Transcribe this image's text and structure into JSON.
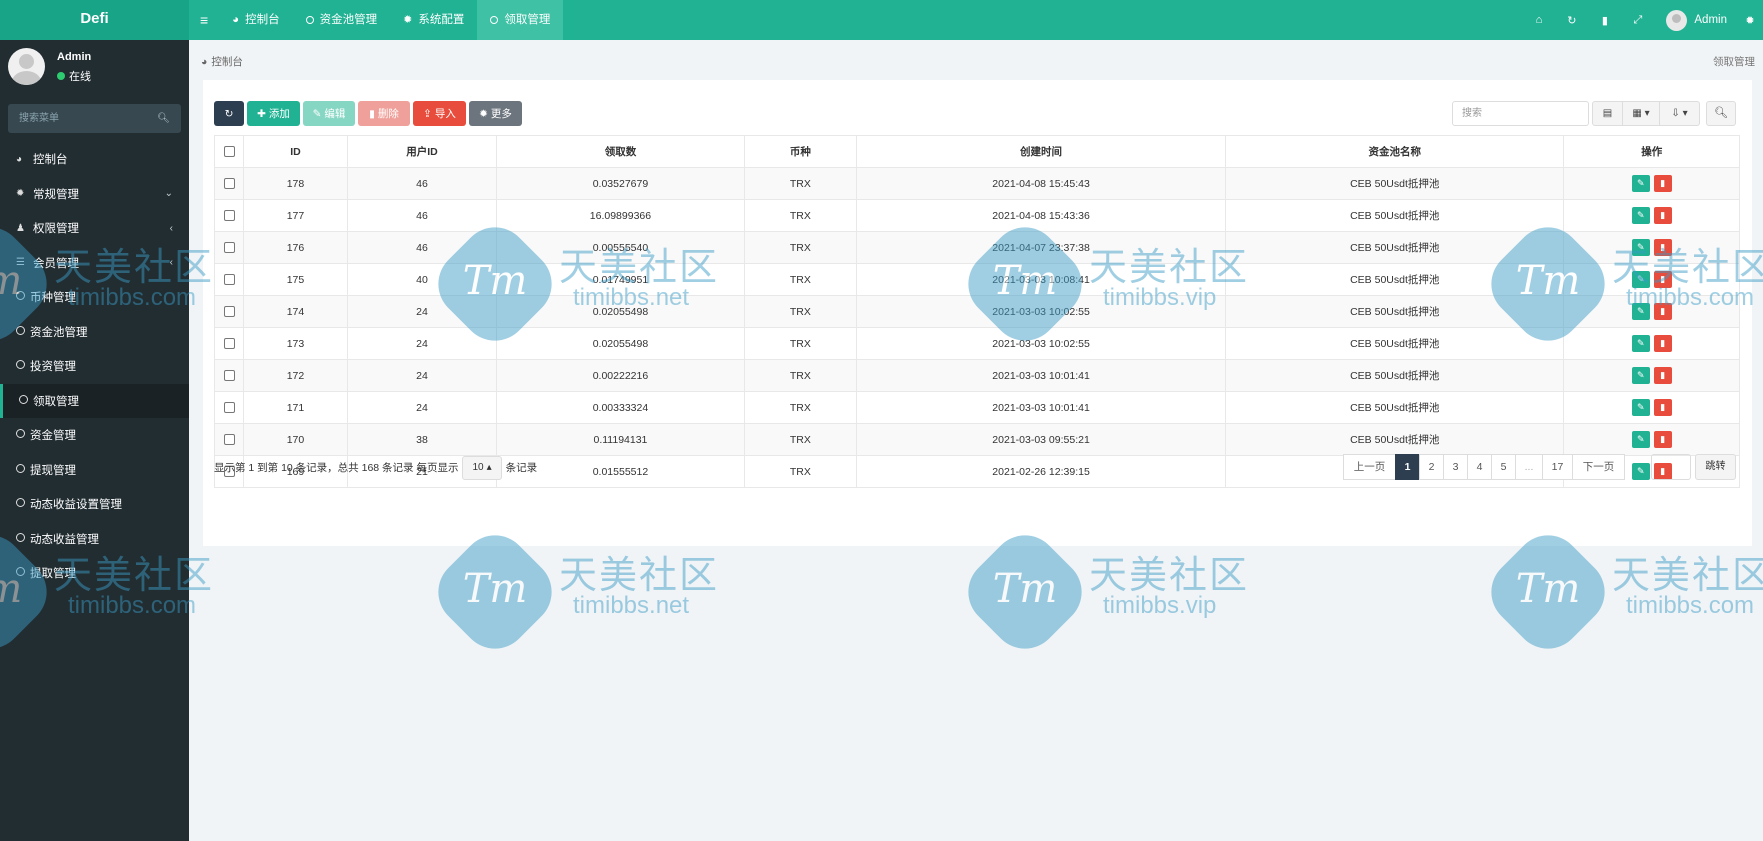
{
  "app": {
    "logo": "Defi"
  },
  "nav": {
    "toggle_icon": "menu-icon",
    "items": [
      {
        "label": "控制台",
        "icon": "dashboard-icon",
        "active": false
      },
      {
        "label": "资金池管理",
        "icon": "circle-icon",
        "active": false
      },
      {
        "label": "系统配置",
        "icon": "gear-icon",
        "active": false
      },
      {
        "label": "领取管理",
        "icon": "circle-icon",
        "active": true
      }
    ]
  },
  "topright": {
    "user_name": "Admin"
  },
  "sidebar": {
    "user": {
      "name": "Admin",
      "status": "在线"
    },
    "search_placeholder": "搜索菜单",
    "menu": [
      {
        "label": "控制台",
        "icon": "dashboard-icon"
      },
      {
        "label": "常规管理",
        "icon": "cogs-icon",
        "caret": "⌄"
      },
      {
        "label": "权限管理",
        "icon": "group-icon",
        "caret": "‹"
      },
      {
        "label": "会员管理",
        "icon": "list-icon",
        "caret": "‹"
      },
      {
        "label": "币种管理",
        "icon": "circle-icon"
      },
      {
        "label": "资金池管理",
        "icon": "circle-icon"
      },
      {
        "label": "投资管理",
        "icon": "circle-icon"
      },
      {
        "label": "领取管理",
        "icon": "circle-icon",
        "active": true
      },
      {
        "label": "资金管理",
        "icon": "circle-icon"
      },
      {
        "label": "提现管理",
        "icon": "circle-icon"
      },
      {
        "label": "动态收益设置管理",
        "icon": "circle-icon"
      },
      {
        "label": "动态收益管理",
        "icon": "circle-icon"
      },
      {
        "label": "提取管理",
        "icon": "circle-icon"
      }
    ]
  },
  "breadcrumb": {
    "home": "控制台",
    "current": "领取管理"
  },
  "toolbar": {
    "add": "添加",
    "edit": "编辑",
    "delete": "删除",
    "import": "导入",
    "more": "更多",
    "search_placeholder": "搜索"
  },
  "table": {
    "columns": [
      "ID",
      "用户ID",
      "领取数",
      "币种",
      "创建时间",
      "资金池名称",
      "操作"
    ],
    "rows": [
      {
        "id": "178",
        "uid": "46",
        "amount": "0.03527679",
        "coin": "TRX",
        "created": "2021-04-08 15:45:43",
        "pool": "CEB 50Usdt抵押池"
      },
      {
        "id": "177",
        "uid": "46",
        "amount": "16.09899366",
        "coin": "TRX",
        "created": "2021-04-08 15:43:36",
        "pool": "CEB 50Usdt抵押池"
      },
      {
        "id": "176",
        "uid": "46",
        "amount": "0.00555540",
        "coin": "TRX",
        "created": "2021-04-07 23:37:38",
        "pool": "CEB 50Usdt抵押池"
      },
      {
        "id": "175",
        "uid": "40",
        "amount": "0.01749951",
        "coin": "TRX",
        "created": "2021-03-03 10:08:41",
        "pool": "CEB 50Usdt抵押池"
      },
      {
        "id": "174",
        "uid": "24",
        "amount": "0.02055498",
        "coin": "TRX",
        "created": "2021-03-03 10:02:55",
        "pool": "CEB 50Usdt抵押池"
      },
      {
        "id": "173",
        "uid": "24",
        "amount": "0.02055498",
        "coin": "TRX",
        "created": "2021-03-03 10:02:55",
        "pool": "CEB 50Usdt抵押池"
      },
      {
        "id": "172",
        "uid": "24",
        "amount": "0.00222216",
        "coin": "TRX",
        "created": "2021-03-03 10:01:41",
        "pool": "CEB 50Usdt抵押池"
      },
      {
        "id": "171",
        "uid": "24",
        "amount": "0.00333324",
        "coin": "TRX",
        "created": "2021-03-03 10:01:41",
        "pool": "CEB 50Usdt抵押池"
      },
      {
        "id": "170",
        "uid": "38",
        "amount": "0.11194131",
        "coin": "TRX",
        "created": "2021-03-03 09:55:21",
        "pool": "CEB 50Usdt抵押池"
      },
      {
        "id": "169",
        "uid": "21",
        "amount": "0.01555512",
        "coin": "TRX",
        "created": "2021-02-26 12:39:15",
        "pool": "CEB 50Usdt抵押池"
      }
    ]
  },
  "pager": {
    "info_prefix": "显示第 1 到第 10 条记录，总共 168 条记录 每页显示",
    "page_size": "10",
    "info_suffix": "条记录",
    "prev": "上一页",
    "pages": [
      "1",
      "2",
      "3",
      "4",
      "5",
      "...",
      "17"
    ],
    "current": "1",
    "next": "下一页",
    "jump": "跳转"
  },
  "watermark": {
    "brand_cn": "天美社区",
    "logo_text": "Tm",
    "url_com": "timibbs.com",
    "url_net": "timibbs.net",
    "url_vip": "timibbs.vip"
  },
  "colors": {
    "brand": "#20b293",
    "sidebar": "#222d32",
    "danger": "#e74c3c",
    "dark": "#2c3e50"
  }
}
